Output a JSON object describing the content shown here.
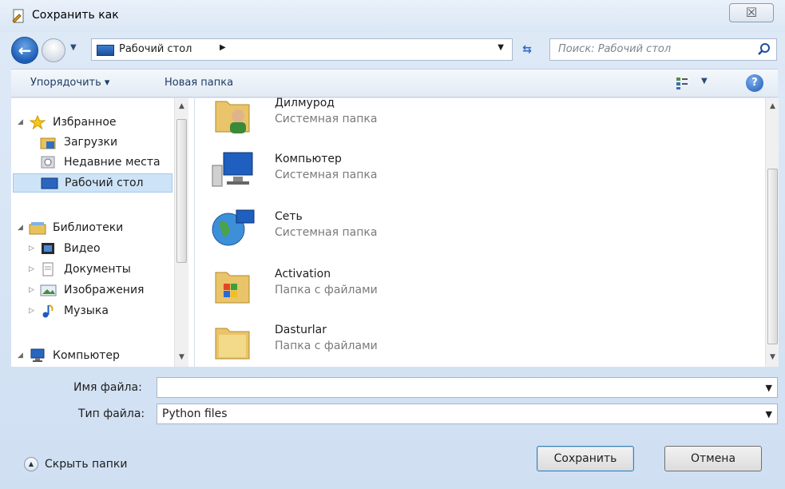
{
  "window": {
    "title": "Сохранить как",
    "close_glyph": "☒"
  },
  "nav": {
    "address": "Рабочий стол",
    "address_sep": "▶",
    "dropdown_glyph": "▼",
    "search_placeholder": "Поиск: Рабочий стол"
  },
  "toolbar": {
    "organize_label": "Упорядочить ▾",
    "new_folder_label": "Новая папка",
    "help_glyph": "?"
  },
  "sidebar": {
    "items": [
      {
        "label": "Избранное",
        "icon": "star-icon",
        "expand": "◢"
      },
      {
        "label": "Загрузки",
        "icon": "downloads-folder-icon"
      },
      {
        "label": "Недавние места",
        "icon": "recent-places-icon"
      },
      {
        "label": "Рабочий стол",
        "icon": "desktop-icon",
        "selected": true
      },
      {
        "label": "Библиотеки",
        "icon": "libraries-icon",
        "expand": "◢"
      },
      {
        "label": "Видео",
        "icon": "video-icon",
        "expand": "▷"
      },
      {
        "label": "Документы",
        "icon": "documents-icon",
        "expand": "▷"
      },
      {
        "label": "Изображения",
        "icon": "pictures-icon",
        "expand": "▷"
      },
      {
        "label": "Музыка",
        "icon": "music-icon",
        "expand": "▷"
      },
      {
        "label": "Компьютер",
        "icon": "computer-icon",
        "expand": "◢"
      }
    ]
  },
  "files": [
    {
      "name": "Дилмурод",
      "type": "Системная папка",
      "icon": "user-folder-icon"
    },
    {
      "name": "Компьютер",
      "type": "Системная папка",
      "icon": "computer-icon"
    },
    {
      "name": "Сеть",
      "type": "Системная папка",
      "icon": "network-icon"
    },
    {
      "name": "Activation",
      "type": "Папка с файлами",
      "icon": "folder-icon"
    },
    {
      "name": "Dasturlar",
      "type": "Папка с файлами",
      "icon": "folder-icon"
    }
  ],
  "form": {
    "filename_label": "Имя файла:",
    "filename_value": "",
    "filetype_label": "Тип файла:",
    "filetype_value": "Python files"
  },
  "footer": {
    "hide_folders_label": "Скрыть папки",
    "save_label": "Сохранить",
    "cancel_label": "Отмена"
  },
  "colors": {
    "selection": "#cde3f8",
    "accent": "#1b5bb4"
  }
}
